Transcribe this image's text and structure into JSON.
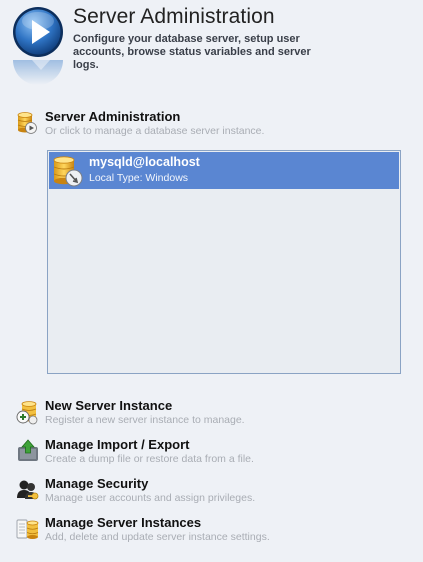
{
  "header": {
    "title": "Server Administration",
    "description": "Configure your database server, setup user accounts, browse status variables and server logs."
  },
  "section": {
    "title": "Server Administration",
    "subtitle": "Or click to manage a database server instance."
  },
  "servers": [
    {
      "name": "mysqld@localhost",
      "info": "Local  Type: Windows"
    }
  ],
  "actions": [
    {
      "title": "New Server Instance",
      "subtitle": "Register a new server instance to manage."
    },
    {
      "title": "Manage Import / Export",
      "subtitle": "Create a dump file or restore data from a file."
    },
    {
      "title": "Manage Security",
      "subtitle": "Manage user accounts and assign privileges."
    },
    {
      "title": "Manage Server Instances",
      "subtitle": "Add, delete and update server instance settings."
    }
  ],
  "icons": {
    "header": "play-icon",
    "section": "database-play-icon",
    "server": "database-server-icon",
    "actions": [
      "new-instance-icon",
      "import-export-icon",
      "security-icon",
      "server-instances-icon"
    ]
  },
  "colors": {
    "accent_blue": "#1f5fa8",
    "selection": "#5a86d2",
    "background": "#eef1f6",
    "subtitle_gray": "#a9adb4"
  }
}
